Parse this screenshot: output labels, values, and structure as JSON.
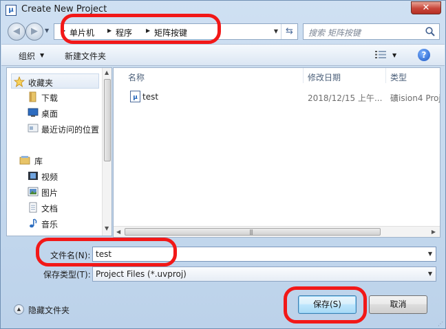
{
  "window": {
    "title": "Create New Project",
    "icon_text": "μ",
    "close_glyph": "✕"
  },
  "navbar": {
    "back_glyph": "◀",
    "forward_glyph": "▶",
    "history_glyph": "▼",
    "breadcrumb": [
      "单片机",
      "程序",
      "矩阵按键"
    ],
    "crumb_separator": "▶",
    "dropdown_glyph": "▼",
    "refresh_glyph": "⇆",
    "search_placeholder": "搜索 矩阵按键",
    "search_icon": "magnifier-icon"
  },
  "toolbar": {
    "organize_label": "组织",
    "organize_arrow": "▼",
    "new_folder_label": "新建文件夹",
    "view_icon": "details-view-icon",
    "view_arrow": "▼",
    "help_glyph": "?"
  },
  "nav_pane": {
    "items": [
      {
        "label": "收藏夹",
        "icon": "star-icon"
      },
      {
        "label": "下载",
        "icon": "folder-icon"
      },
      {
        "label": "桌面",
        "icon": "desktop-icon"
      },
      {
        "label": "最近访问的位置",
        "icon": "recent-places-icon"
      },
      {
        "label": "库",
        "icon": "library-icon"
      },
      {
        "label": "视频",
        "icon": "video-icon"
      },
      {
        "label": "图片",
        "icon": "picture-icon"
      },
      {
        "label": "文档",
        "icon": "document-icon"
      },
      {
        "label": "音乐",
        "icon": "music-icon"
      }
    ],
    "scroll_up_glyph": "▲",
    "scroll_down_glyph": "▼"
  },
  "file_list": {
    "columns": [
      "名称",
      "修改日期",
      "类型"
    ],
    "sort_glyph": "ˆ",
    "rows": [
      {
        "name": "test",
        "date": "2018/12/15 上午...",
        "type": "礦ision4 Proj",
        "icon": "uvision-project-icon"
      }
    ],
    "hscroll_left_glyph": "◀",
    "hscroll_right_glyph": "▶",
    "hscroll_grip": "|||"
  },
  "form": {
    "filename_label": "文件名(N):",
    "filename_value": "test",
    "filename_arrow": "▼",
    "type_label": "保存类型(T):",
    "type_value": "Project Files (*.uvproj)",
    "type_arrow": "▼"
  },
  "footer": {
    "hide_folders_label": "隐藏文件夹",
    "hide_glyph": "▲",
    "save_label": "保存(S)",
    "cancel_label": "取消",
    "grip_glyph": "⋰"
  },
  "colors": {
    "annotation": "#f21818",
    "window_frame": "#bcd2ea",
    "accent_button": "#bee6fd"
  }
}
